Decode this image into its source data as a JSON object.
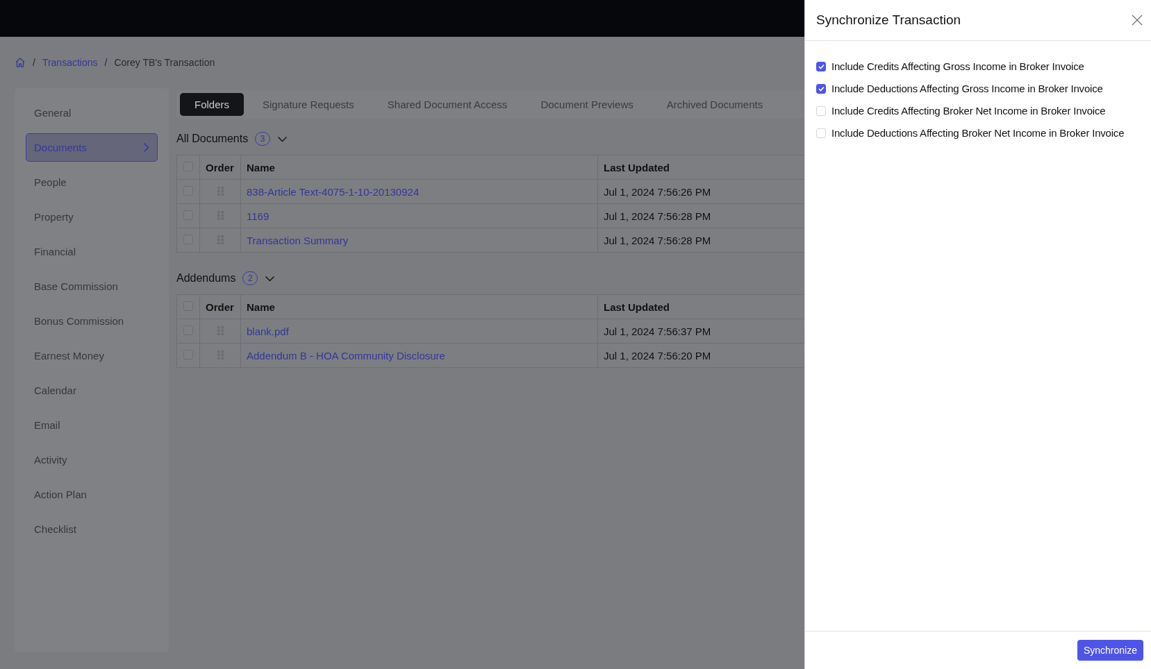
{
  "breadcrumb": {
    "items": [
      {
        "separator": "/",
        "label": "Transactions",
        "kind": "link"
      },
      {
        "separator": "/",
        "label": "Corey TB's Transaction",
        "kind": "current"
      }
    ]
  },
  "sidebar": {
    "items": [
      {
        "label": "General",
        "selected": false
      },
      {
        "label": "Documents",
        "selected": true
      },
      {
        "label": "People",
        "selected": false
      },
      {
        "label": "Property",
        "selected": false
      },
      {
        "label": "Financial",
        "selected": false
      },
      {
        "label": "Base Commission",
        "selected": false
      },
      {
        "label": "Bonus Commission",
        "selected": false
      },
      {
        "label": "Earnest Money",
        "selected": false
      },
      {
        "label": "Calendar",
        "selected": false
      },
      {
        "label": "Email",
        "selected": false
      },
      {
        "label": "Activity",
        "selected": false
      },
      {
        "label": "Action Plan",
        "selected": false
      },
      {
        "label": "Checklist",
        "selected": false
      }
    ]
  },
  "tabs": [
    {
      "label": "Folders",
      "selected": true
    },
    {
      "label": "Signature Requests",
      "selected": false
    },
    {
      "label": "Shared Document Access",
      "selected": false
    },
    {
      "label": "Document Previews",
      "selected": false
    },
    {
      "label": "Archived Documents",
      "selected": false
    }
  ],
  "sections": [
    {
      "title": "All Documents",
      "count": "3",
      "expanded": true,
      "all_checked": false,
      "columns": [
        "Order",
        "Name",
        "Last Updated"
      ],
      "rows": [
        {
          "name": "838-Article Text-4075-1-10-20130924",
          "updated": "Jul 1, 2024 7:56:26 PM",
          "checked": false
        },
        {
          "name": "1169",
          "updated": "Jul 1, 2024 7:56:28 PM",
          "checked": false
        },
        {
          "name": "Transaction Summary",
          "updated": "Jul 1, 2024 7:56:28 PM",
          "checked": false
        }
      ]
    },
    {
      "title": "Addendums",
      "count": "2",
      "expanded": true,
      "all_checked": false,
      "columns": [
        "Order",
        "Name",
        "Last Updated"
      ],
      "rows": [
        {
          "name": "blank.pdf",
          "updated": "Jul 1, 2024 7:56:37 PM",
          "checked": false
        },
        {
          "name": "Addendum B - HOA Community Disclosure",
          "updated": "Jul 1, 2024 7:56:20 PM",
          "checked": false
        }
      ]
    }
  ],
  "drawer": {
    "title": "Synchronize Transaction",
    "options": [
      {
        "label": "Include Credits Affecting Gross Income in Broker Invoice",
        "checked": true
      },
      {
        "label": "Include Deductions Affecting Gross Income in Broker Invoice",
        "checked": true
      },
      {
        "label": "Include Credits Affecting Broker Net Income in Broker Invoice",
        "checked": false
      },
      {
        "label": "Include Deductions Affecting Broker Net Income in Broker Invoice",
        "checked": false
      }
    ],
    "button": "Synchronize"
  }
}
